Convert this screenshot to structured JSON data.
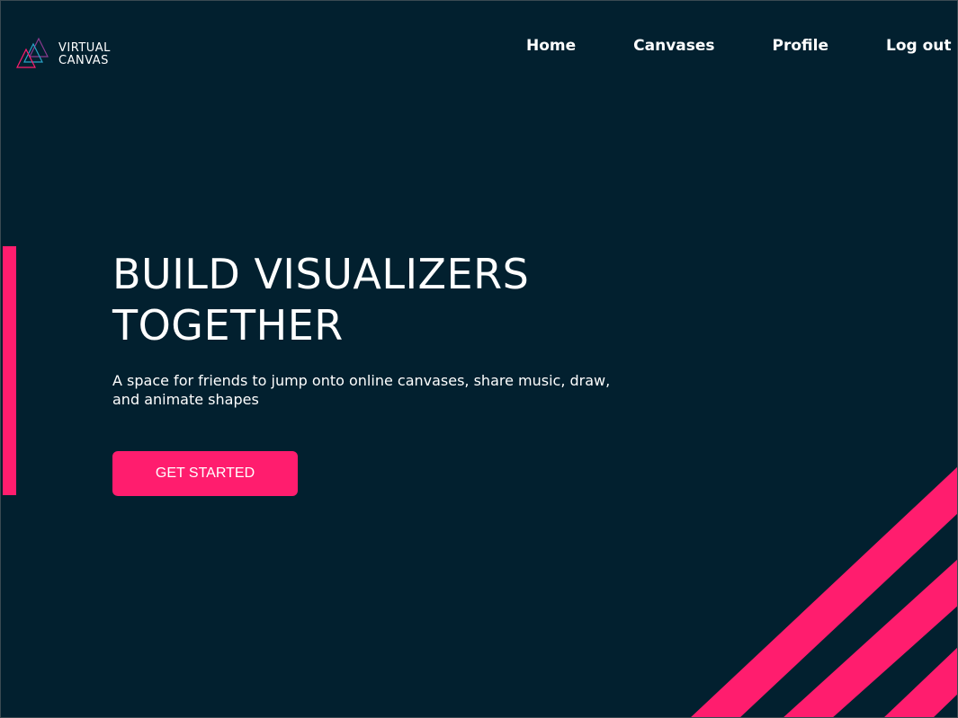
{
  "brand": {
    "line1": "VIRTUAL",
    "line2": "CANVAS",
    "logo_icon": "triangles-logo-icon"
  },
  "nav": {
    "home": "Home",
    "canvases": "Canvases",
    "profile": "Profile",
    "logout": "Log out"
  },
  "hero": {
    "title_line1": "BUILD VISUALIZERS",
    "title_line2": "TOGETHER",
    "subtitle": "A space for friends to jump onto online canvases, share music, draw, and animate shapes",
    "cta_label": "GET STARTED"
  },
  "colors": {
    "background": "#02202f",
    "accent": "#ff1d6e",
    "text": "#ffffff"
  }
}
